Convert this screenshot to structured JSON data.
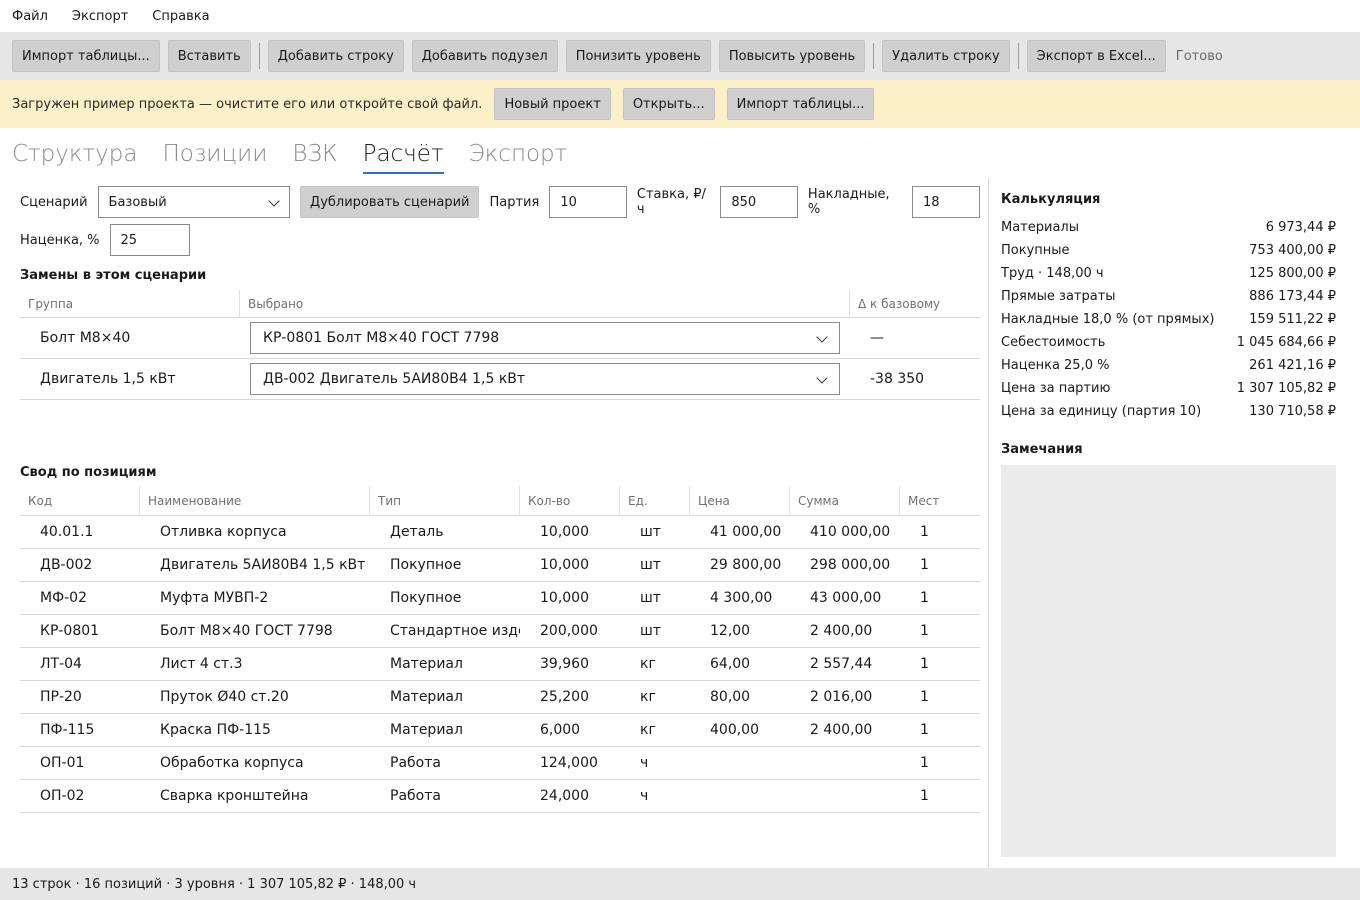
{
  "menu": [
    "Файл",
    "Экспорт",
    "Справка"
  ],
  "toolbar": {
    "import_table": "Импорт таблицы...",
    "insert": "Вставить",
    "add_row": "Добавить строку",
    "add_subnode": "Добавить подузел",
    "demote": "Понизить уровень",
    "promote": "Повысить уровень",
    "delete_row": "Удалить строку",
    "export_excel": "Экспорт в Excel...",
    "status": "Готово"
  },
  "banner": {
    "message": "Загружен пример проекта — очистите его или откройте свой файл.",
    "new_project": "Новый проект",
    "open": "Открыть...",
    "import_table": "Импорт таблицы..."
  },
  "tabs": [
    "Структура",
    "Позиции",
    "ВЗК",
    "Расчёт",
    "Экспорт"
  ],
  "active_tab": "Расчёт",
  "params": {
    "scenario_label": "Сценарий",
    "scenario_value": "Базовый",
    "duplicate_label": "Дублировать сценарий",
    "batch_label": "Партия",
    "batch_value": "10",
    "rate_label": "Ставка, ₽/ч",
    "rate_value": "850",
    "overhead_label": "Накладные, %",
    "overhead_value": "18",
    "markup_label": "Наценка, %",
    "markup_value": "25"
  },
  "replacements": {
    "title": "Замены в этом сценарии",
    "headers": [
      "Группа",
      "Выбрано",
      "Δ к базовому"
    ],
    "rows": [
      {
        "group": "Болт М8×40",
        "selected": "КР-0801 Болт М8×40 ГОСТ 7798",
        "delta": "—"
      },
      {
        "group": "Двигатель 1,5 кВт",
        "selected": "ДВ-002 Двигатель 5АИ80В4 1,5 кВт",
        "delta": "-38 350"
      }
    ]
  },
  "summary": {
    "title": "Свод по позициям",
    "headers": [
      "Код",
      "Наименование",
      "Тип",
      "Кол-во",
      "Ед.",
      "Цена",
      "Сумма",
      "Мест"
    ],
    "rows": [
      {
        "code": "40.01.1",
        "name": "Отливка корпуса",
        "type": "Деталь",
        "qty": "10,000",
        "unit": "шт",
        "price": "41 000,00",
        "sum": "410 000,00",
        "seats": "1"
      },
      {
        "code": "ДВ-002",
        "name": "Двигатель 5АИ80В4 1,5 кВт",
        "type": "Покупное",
        "qty": "10,000",
        "unit": "шт",
        "price": "29 800,00",
        "sum": "298 000,00",
        "seats": "1"
      },
      {
        "code": "МФ-02",
        "name": "Муфта МУВП-2",
        "type": "Покупное",
        "qty": "10,000",
        "unit": "шт",
        "price": "4 300,00",
        "sum": "43 000,00",
        "seats": "1"
      },
      {
        "code": "КР-0801",
        "name": "Болт М8×40 ГОСТ 7798",
        "type": "Стандартное изделие",
        "qty": "200,000",
        "unit": "шт",
        "price": "12,00",
        "sum": "2 400,00",
        "seats": "1"
      },
      {
        "code": "ЛТ-04",
        "name": "Лист 4 ст.3",
        "type": "Материал",
        "qty": "39,960",
        "unit": "кг",
        "price": "64,00",
        "sum": "2 557,44",
        "seats": "1"
      },
      {
        "code": "ПР-20",
        "name": "Пруток Ø40 ст.20",
        "type": "Материал",
        "qty": "25,200",
        "unit": "кг",
        "price": "80,00",
        "sum": "2 016,00",
        "seats": "1"
      },
      {
        "code": "ПФ-115",
        "name": "Краска ПФ-115",
        "type": "Материал",
        "qty": "6,000",
        "unit": "кг",
        "price": "400,00",
        "sum": "2 400,00",
        "seats": "1"
      },
      {
        "code": "ОП-01",
        "name": "Обработка корпуса",
        "type": "Работа",
        "qty": "124,000",
        "unit": "ч",
        "price": "",
        "sum": "",
        "seats": "1"
      },
      {
        "code": "ОП-02",
        "name": "Сварка кронштейна",
        "type": "Работа",
        "qty": "24,000",
        "unit": "ч",
        "price": "",
        "sum": "",
        "seats": "1"
      }
    ]
  },
  "calculation": {
    "title": "Калькуляция",
    "rows": [
      {
        "label": "Материалы",
        "value": "6 973,44 ₽"
      },
      {
        "label": "Покупные",
        "value": "753 400,00 ₽"
      },
      {
        "label": "Труд · 148,00 ч",
        "value": "125 800,00 ₽"
      },
      {
        "label": "Прямые затраты",
        "value": "886 173,44 ₽"
      },
      {
        "label": "Накладные 18,0 % (от прямых)",
        "value": "159 511,22 ₽"
      },
      {
        "label": "Себестоимость",
        "value": "1 045 684,66 ₽"
      },
      {
        "label": "Наценка 25,0 %",
        "value": "261 421,16 ₽"
      },
      {
        "label": "Цена за партию",
        "value": "1 307 105,82 ₽"
      },
      {
        "label": "Цена за единицу (партия 10)",
        "value": "130 710,58 ₽"
      }
    ]
  },
  "notes": {
    "title": "Замечания"
  },
  "statusbar": "13 строк · 16 позиций · 3 уровня · 1 307 105,82 ₽ · 148,00 ч",
  "colors": {
    "toolbar_bg": "#e6e6e6",
    "banner_bg": "#fcf0c8",
    "accent": "#2a6fd1",
    "button_bg": "#cfcfcf"
  }
}
